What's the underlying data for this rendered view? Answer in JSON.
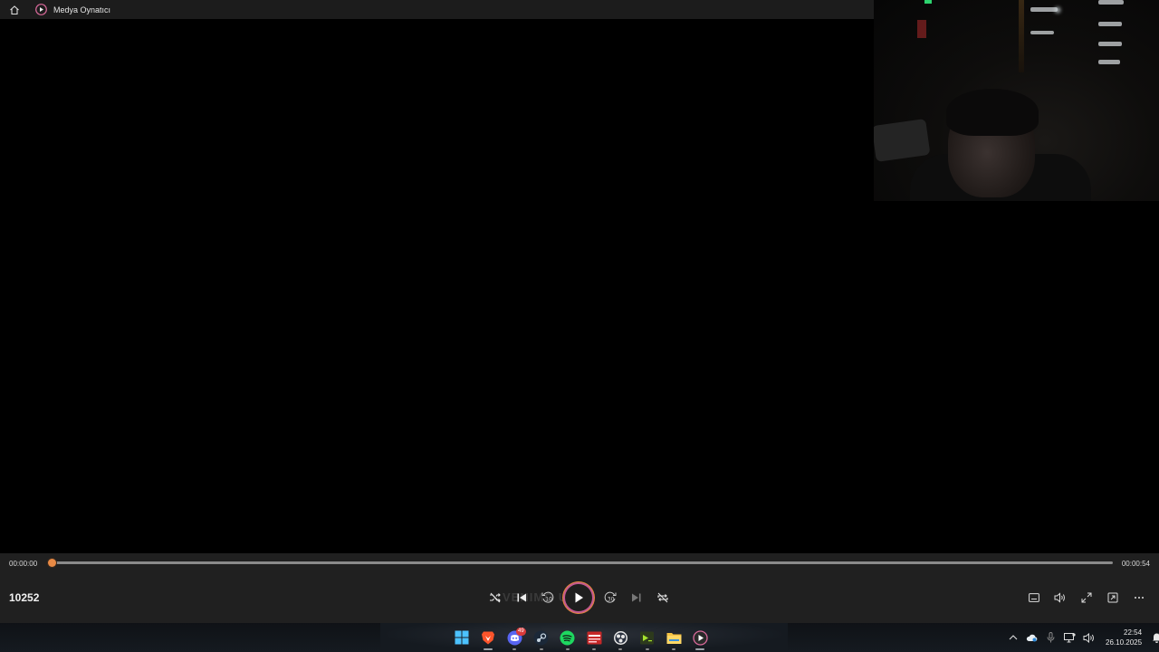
{
  "window": {
    "title": "Medya Oynatıcı"
  },
  "player": {
    "current_time": "00:00:00",
    "total_time": "00:00:54",
    "progress_fraction": 0.0,
    "media_title": "10252",
    "watermark_text": "VENIMO UNIT",
    "accent_color": "#e0803a"
  },
  "taskbar": {
    "discord_badge": "49",
    "clock_time": "22:54",
    "clock_date": "26.10.2025"
  }
}
